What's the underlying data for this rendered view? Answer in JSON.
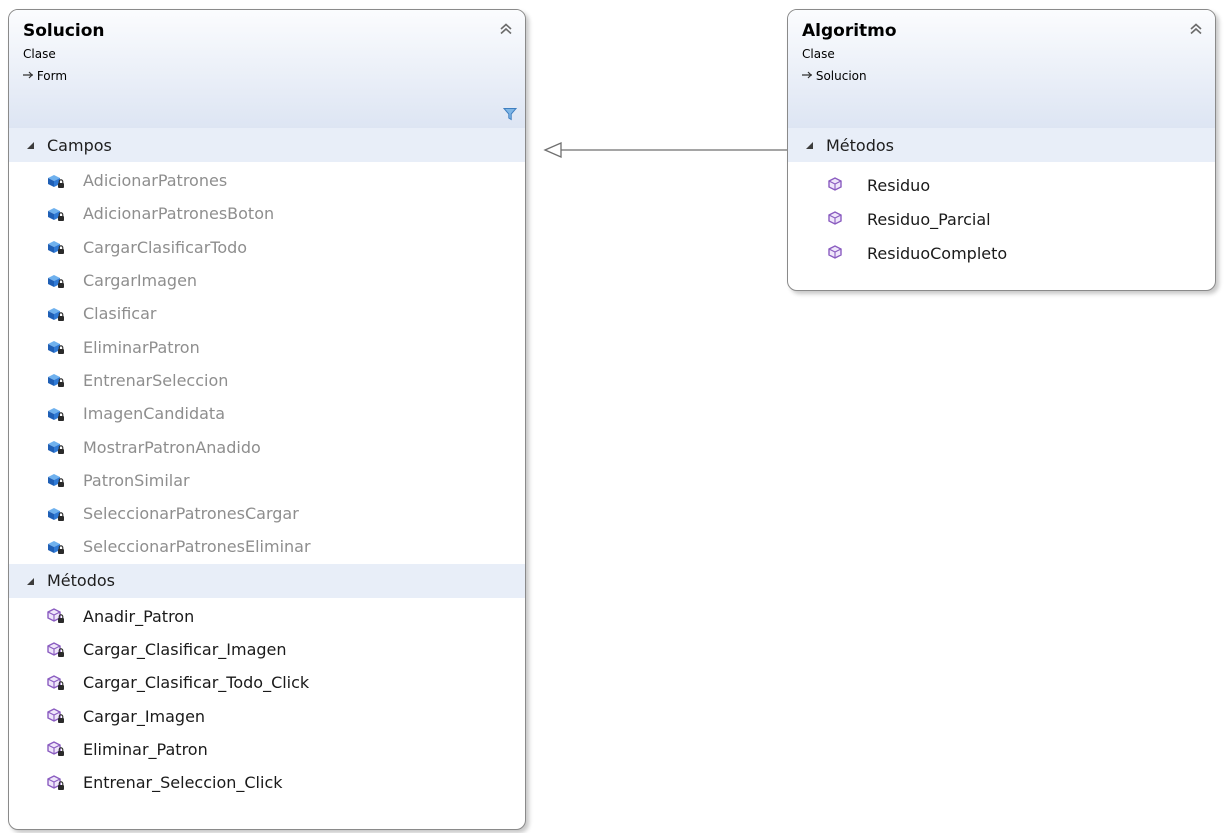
{
  "classes": {
    "solucion": {
      "name": "Solucion",
      "kind": "Clase",
      "base": "Form",
      "fields_label": "Campos",
      "fields": [
        "AdicionarPatrones",
        "AdicionarPatronesBoton",
        "CargarClasificarTodo",
        "CargarImagen",
        "Clasificar",
        "EliminarPatron",
        "EntrenarSeleccion",
        "ImagenCandidata",
        "MostrarPatronAnadido",
        "PatronSimilar",
        "SeleccionarPatronesCargar",
        "SeleccionarPatronesEliminar"
      ],
      "methods_label": "Métodos",
      "methods": [
        "Anadir_Patron",
        "Cargar_Clasificar_Imagen",
        "Cargar_Clasificar_Todo_Click",
        "Cargar_Imagen",
        "Eliminar_Patron",
        "Entrenar_Seleccion_Click"
      ]
    },
    "algoritmo": {
      "name": "Algoritmo",
      "kind": "Clase",
      "base": "Solucion",
      "methods_label": "Métodos",
      "methods": [
        "Residuo",
        "Residuo_Parcial",
        "ResiduoCompleto"
      ]
    }
  },
  "icons": {
    "field": "private-field-icon",
    "private_method": "private-method-icon",
    "public_method": "public-method-icon",
    "collapse": "double-chevron-up-icon",
    "filter": "filter-icon",
    "expanded": "triangle-expanded-icon",
    "inheritance": "arrow-inherits-icon"
  },
  "colors": {
    "header_top": "#fbfcfe",
    "header_bottom": "#dde5f3",
    "section_bg": "#e8eef8",
    "field_text": "#8e8e8e",
    "method_icon": "#8a5cc0",
    "field_icon": "#2f6fc7",
    "border": "#8a8a8a"
  }
}
